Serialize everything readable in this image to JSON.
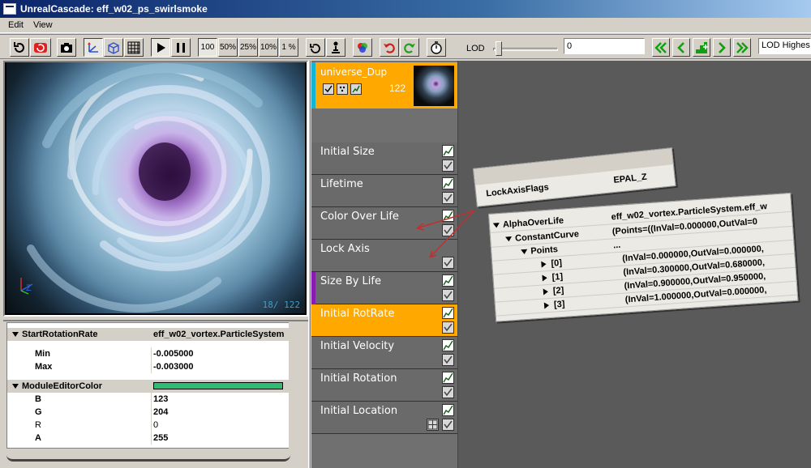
{
  "window": {
    "title": "UnrealCascade: eff_w02_ps_swirlsmoke"
  },
  "menu": {
    "edit": "Edit",
    "view": "View"
  },
  "toolbar": {
    "speed_100": "100",
    "speed_50": "50%",
    "speed_25": "25%",
    "speed_10": "10%",
    "speed_1": "1 %",
    "lod_label": "LOD",
    "lod_value": "0",
    "lod_select": "LOD Highest"
  },
  "viewport": {
    "particle_count": "18/ 122"
  },
  "properties": {
    "start_rotation_rate": {
      "label": "StartRotationRate",
      "value": "eff_w02_vortex.ParticleSystem"
    },
    "min": {
      "label": "Min",
      "value": "-0.005000"
    },
    "max": {
      "label": "Max",
      "value": "-0.003000"
    },
    "module_editor_color": {
      "label": "ModuleEditorColor",
      "color": "#2ebd72"
    },
    "b": {
      "label": "B",
      "value": "123"
    },
    "g": {
      "label": "G",
      "value": "204"
    },
    "r": {
      "label": "R",
      "value": "0"
    },
    "a": {
      "label": "A",
      "value": "255"
    }
  },
  "emitter": {
    "name": "universe_Dup",
    "count": "122",
    "accent": "#ffa800",
    "stripe": "#14b4d4"
  },
  "modules": [
    {
      "label": "Initial Size"
    },
    {
      "label": "Lifetime"
    },
    {
      "label": "Color Over Life"
    },
    {
      "label": "Lock Axis"
    },
    {
      "label": "Size By Life"
    },
    {
      "label": "Initial RotRate"
    },
    {
      "label": "Initial Velocity"
    },
    {
      "label": "Initial Rotation"
    },
    {
      "label": "Initial Location"
    }
  ],
  "graph": {
    "lock_node": {
      "key": "LockAxisFlags",
      "value": "EPAL_Z"
    },
    "alpha_node": {
      "key": "AlphaOverLife",
      "value": "eff_w02_vortex.ParticleSystem.eff_w",
      "constant_curve": "ConstantCurve",
      "constant_curve_value": "(Points=((InVal=0.000000,OutVal=0",
      "points": "Points",
      "points_value": "...",
      "p0": "[0]",
      "p0_value": "(InVal=0.000000,OutVal=0.000000,",
      "p1": "[1]",
      "p1_value": "(InVal=0.300000,OutVal=0.680000,",
      "p2": "[2]",
      "p2_value": "(InVal=0.900000,OutVal=0.950000,",
      "p3": "[3]",
      "p3_value": "(InVal=1.000000,OutVal=0.000000,"
    }
  },
  "colors": {
    "selected": "#ffa800",
    "size_stripe": "#8a1ab4",
    "connector": "#c03030"
  }
}
